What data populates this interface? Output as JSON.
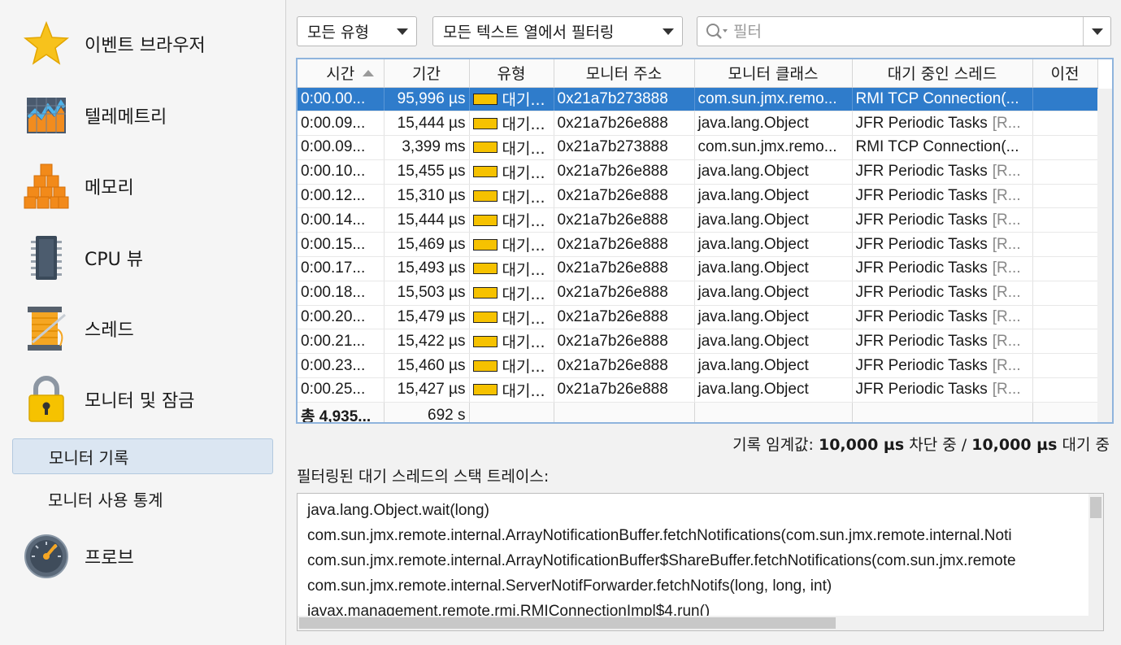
{
  "sidebar": {
    "items": [
      {
        "label": "이벤트 브라우저",
        "icon": "star-icon"
      },
      {
        "label": "텔레메트리",
        "icon": "telemetry-chart-icon"
      },
      {
        "label": "메모리",
        "icon": "memory-blocks-icon"
      },
      {
        "label": "CPU 뷰",
        "icon": "cpu-chip-icon"
      },
      {
        "label": "스레드",
        "icon": "thread-spool-icon"
      },
      {
        "label": "모니터 및 잠금",
        "icon": "padlock-icon"
      },
      {
        "label": "프로브",
        "icon": "gauge-icon"
      }
    ],
    "sub_items": [
      {
        "label": "모니터 기록",
        "selected": true
      },
      {
        "label": "모니터 사용 통계",
        "selected": false
      }
    ]
  },
  "toolbar": {
    "type_filter": "모든 유형",
    "column_filter": "모든 텍스트 열에서 필터링",
    "filter_placeholder": "필터"
  },
  "table": {
    "columns": [
      "시간",
      "기간",
      "유형",
      "모니터 주소",
      "모니터 클래스",
      "대기 중인 스레드",
      "이전"
    ],
    "rows": [
      {
        "time": "0:00.00...",
        "duration": "95,996 µs",
        "type": "대기...",
        "address": "0x21a7b273888",
        "class": "com.sun.jmx.remo...",
        "thread": "RMI TCP Connection(...",
        "thread_suffix": "",
        "selected": true
      },
      {
        "time": "0:00.09...",
        "duration": "15,444 µs",
        "type": "대기...",
        "address": "0x21a7b26e888",
        "class": "java.lang.Object",
        "thread": "JFR Periodic Tasks",
        "thread_suffix": "[R...",
        "selected": false
      },
      {
        "time": "0:00.09...",
        "duration": "3,399 ms",
        "type": "대기...",
        "address": "0x21a7b273888",
        "class": "com.sun.jmx.remo...",
        "thread": "RMI TCP Connection(...",
        "thread_suffix": "",
        "selected": false
      },
      {
        "time": "0:00.10...",
        "duration": "15,455 µs",
        "type": "대기...",
        "address": "0x21a7b26e888",
        "class": "java.lang.Object",
        "thread": "JFR Periodic Tasks",
        "thread_suffix": "[R...",
        "selected": false
      },
      {
        "time": "0:00.12...",
        "duration": "15,310 µs",
        "type": "대기...",
        "address": "0x21a7b26e888",
        "class": "java.lang.Object",
        "thread": "JFR Periodic Tasks",
        "thread_suffix": "[R...",
        "selected": false
      },
      {
        "time": "0:00.14...",
        "duration": "15,444 µs",
        "type": "대기...",
        "address": "0x21a7b26e888",
        "class": "java.lang.Object",
        "thread": "JFR Periodic Tasks",
        "thread_suffix": "[R...",
        "selected": false
      },
      {
        "time": "0:00.15...",
        "duration": "15,469 µs",
        "type": "대기...",
        "address": "0x21a7b26e888",
        "class": "java.lang.Object",
        "thread": "JFR Periodic Tasks",
        "thread_suffix": "[R...",
        "selected": false
      },
      {
        "time": "0:00.17...",
        "duration": "15,493 µs",
        "type": "대기...",
        "address": "0x21a7b26e888",
        "class": "java.lang.Object",
        "thread": "JFR Periodic Tasks",
        "thread_suffix": "[R...",
        "selected": false
      },
      {
        "time": "0:00.18...",
        "duration": "15,503 µs",
        "type": "대기...",
        "address": "0x21a7b26e888",
        "class": "java.lang.Object",
        "thread": "JFR Periodic Tasks",
        "thread_suffix": "[R...",
        "selected": false
      },
      {
        "time": "0:00.20...",
        "duration": "15,479 µs",
        "type": "대기...",
        "address": "0x21a7b26e888",
        "class": "java.lang.Object",
        "thread": "JFR Periodic Tasks",
        "thread_suffix": "[R...",
        "selected": false
      },
      {
        "time": "0:00.21...",
        "duration": "15,422 µs",
        "type": "대기...",
        "address": "0x21a7b26e888",
        "class": "java.lang.Object",
        "thread": "JFR Periodic Tasks",
        "thread_suffix": "[R...",
        "selected": false
      },
      {
        "time": "0:00.23...",
        "duration": "15,460 µs",
        "type": "대기...",
        "address": "0x21a7b26e888",
        "class": "java.lang.Object",
        "thread": "JFR Periodic Tasks",
        "thread_suffix": "[R...",
        "selected": false
      },
      {
        "time": "0:00.25...",
        "duration": "15,427 µs",
        "type": "대기...",
        "address": "0x21a7b26e888",
        "class": "java.lang.Object",
        "thread": "JFR Periodic Tasks",
        "thread_suffix": "[R...",
        "selected": false
      }
    ],
    "footer": {
      "total": "총 4,935...",
      "duration": "692 s"
    }
  },
  "threshold": {
    "prefix": "기록 임계값:",
    "blocking_value": "10,000 µs",
    "blocking_label": "차단 중 /",
    "waiting_value": "10,000 µs",
    "waiting_label": "대기 중"
  },
  "stack": {
    "label": "필터링된 대기 스레드의 스택 트레이스:",
    "lines": [
      "java.lang.Object.wait(long)",
      "com.sun.jmx.remote.internal.ArrayNotificationBuffer.fetchNotifications(com.sun.jmx.remote.internal.Noti",
      "com.sun.jmx.remote.internal.ArrayNotificationBuffer$ShareBuffer.fetchNotifications(com.sun.jmx.remote",
      "com.sun.jmx.remote.internal.ServerNotifForwarder.fetchNotifs(long, long, int)",
      "javax.management.remote.rmi.RMIConnectionImpl$4.run()"
    ]
  },
  "colors": {
    "selection": "#2f7ccb",
    "type_chip": "#f6c200",
    "table_border": "#8fb4dd"
  }
}
